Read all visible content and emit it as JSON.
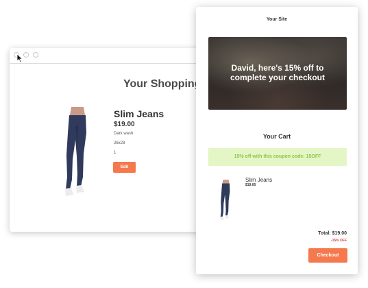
{
  "browser": {
    "title": "Your Shopping C",
    "product": {
      "name": "Slim Jeans",
      "price": "$19.00",
      "description": "Dark wash",
      "size": "26x28",
      "quantity": "1",
      "edit_label": "Edit"
    }
  },
  "email": {
    "site_name": "Your Site",
    "hero_text": "David, here's 15% off to complete your checkout",
    "cart_title": "Your Cart",
    "coupon_text": "15% off with this coupon code: 15OFF",
    "item": {
      "name": "Slim Jeans",
      "price": "$19.00"
    },
    "total": "Total: $19.00",
    "discount": "-15% OFF",
    "checkout_label": "Checkout"
  },
  "colors": {
    "accent": "#f47a4d",
    "coupon_bg": "#e5f6c6",
    "coupon_text": "#8cc34a",
    "discount": "#e03a3a"
  },
  "icons": [
    "cursor-icon"
  ]
}
